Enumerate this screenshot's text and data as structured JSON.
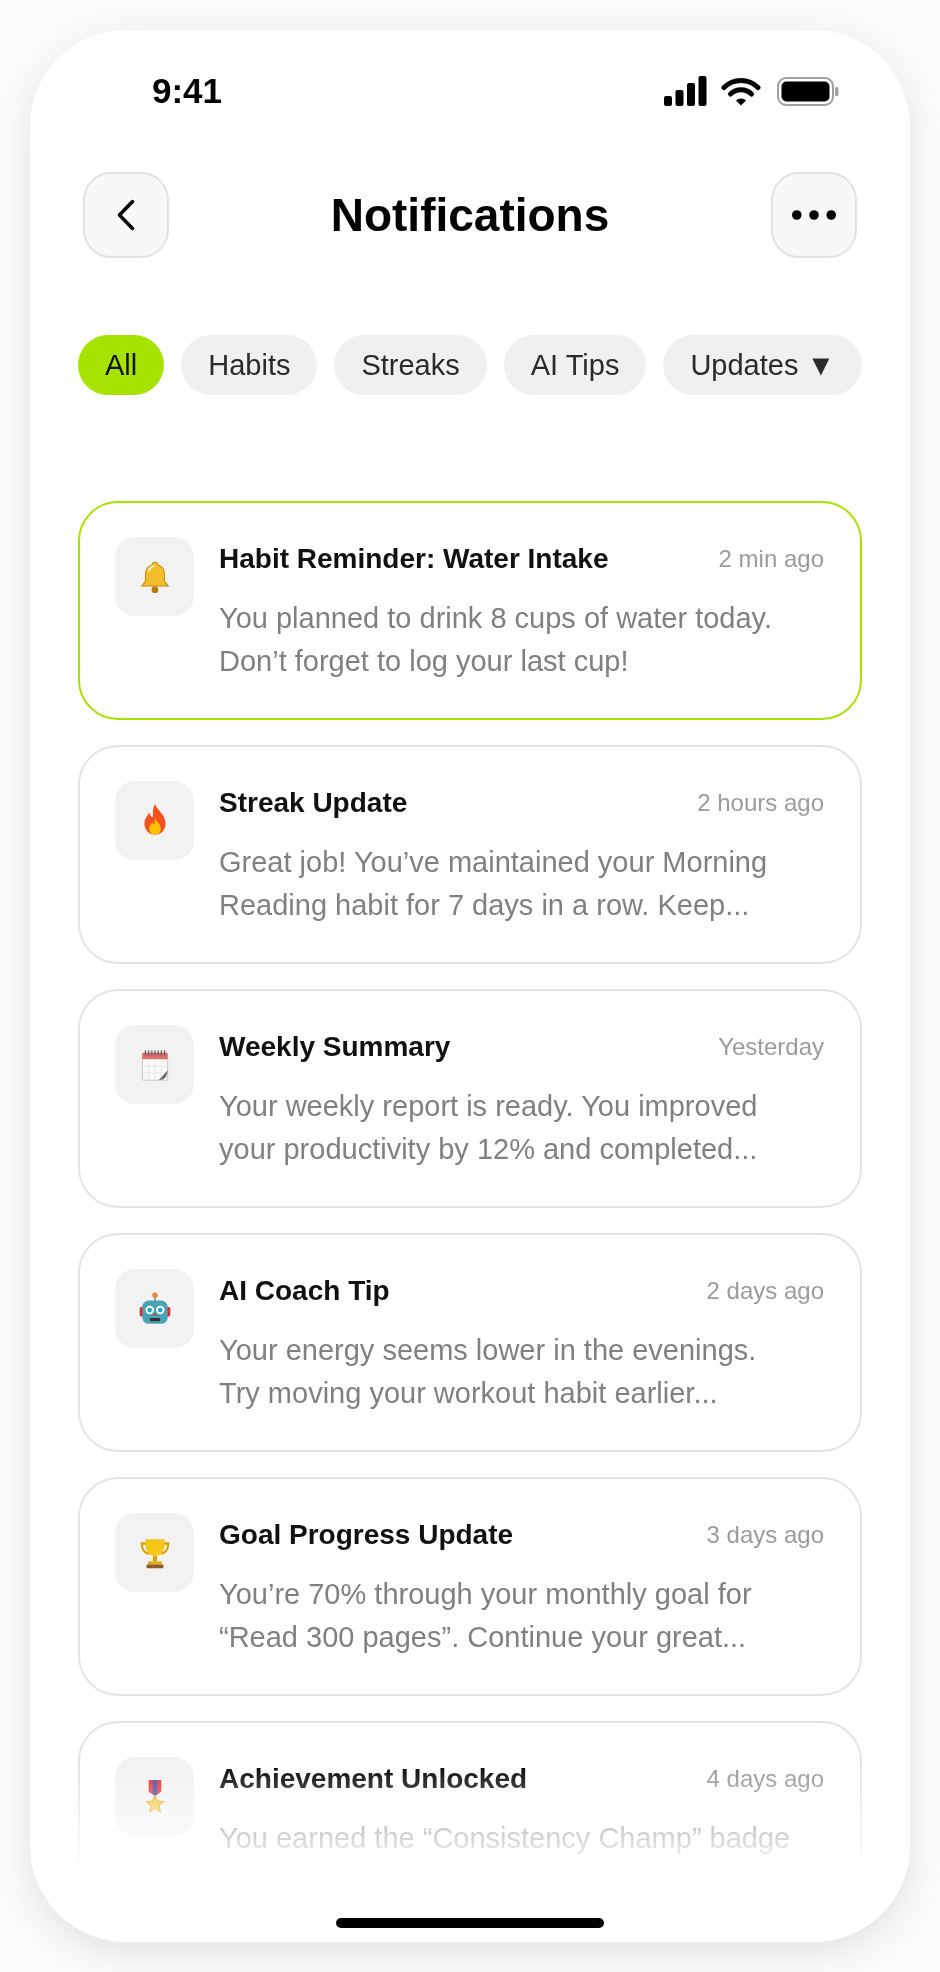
{
  "status_bar": {
    "time": "9:41"
  },
  "header": {
    "title": "Notifications"
  },
  "filters": [
    {
      "label": "All",
      "selected": true
    },
    {
      "label": "Habits",
      "selected": false
    },
    {
      "label": "Streaks",
      "selected": false
    },
    {
      "label": "AI Tips",
      "selected": false
    },
    {
      "label": "Updates ▼",
      "selected": false
    }
  ],
  "notifications": [
    {
      "kind": "reminder",
      "title": "Habit Reminder: Water Intake",
      "time": "2 min ago",
      "body": "You planned to drink 8 cups of water today. Don’t forget to log your last cup!",
      "highlighted": true
    },
    {
      "kind": "streak",
      "title": "Streak Update",
      "time": "2 hours ago",
      "body": "Great job! You’ve maintained your Morning Reading habit for 7 days in a row. Keep...",
      "highlighted": false
    },
    {
      "kind": "summary",
      "title": "Weekly Summary",
      "time": "Yesterday",
      "body": "Your weekly report is ready. You improved your productivity by 12% and completed...",
      "highlighted": false
    },
    {
      "kind": "tip",
      "title": "AI Coach Tip",
      "time": "2 days ago",
      "body": "Your energy seems lower in the evenings. Try moving your workout habit earlier...",
      "highlighted": false
    },
    {
      "kind": "goal",
      "title": "Goal Progress Update",
      "time": "3 days ago",
      "body": "You’re 70% through your monthly goal for “Read 300 pages”. Continue your great...",
      "highlighted": false
    },
    {
      "kind": "achievement",
      "title": "Achievement Unlocked",
      "time": "4 days ago",
      "body": "You earned the “Consistency Champ” badge",
      "highlighted": false
    }
  ]
}
